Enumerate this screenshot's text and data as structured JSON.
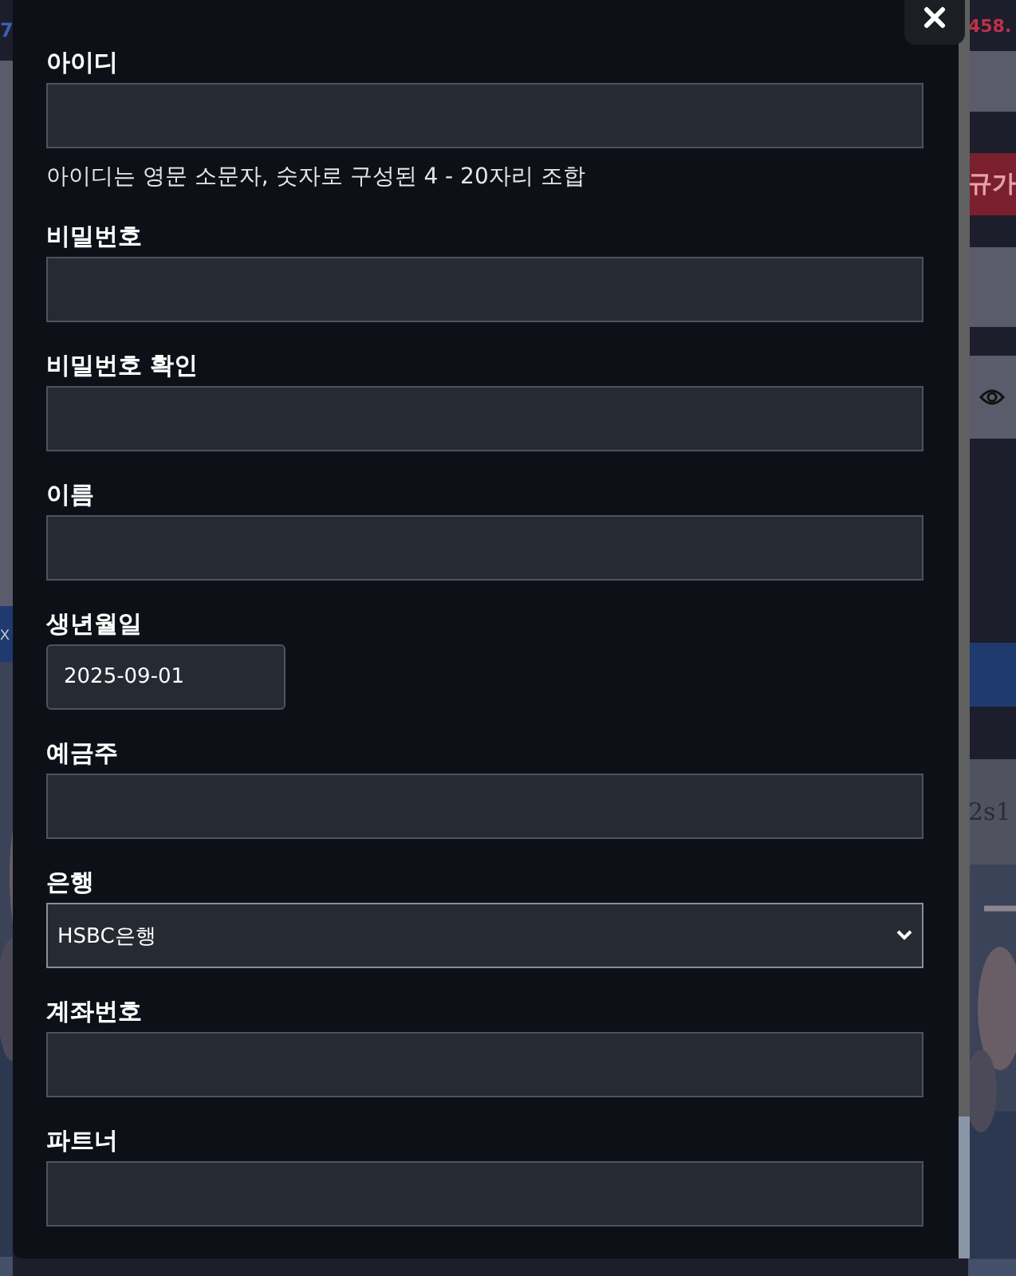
{
  "background": {
    "corner_text": "7",
    "price_text": "458.",
    "signup_button": "규가",
    "side_button": "X",
    "banner_text": "2s1"
  },
  "modal": {
    "fields": [
      {
        "kind": "text",
        "label": "아이디",
        "hint": "아이디는 영문 소문자, 숫자로 구성된 4 - 20자리 조합"
      },
      {
        "kind": "password",
        "label": "비밀번호"
      },
      {
        "kind": "password",
        "label": "비밀번호 확인"
      },
      {
        "kind": "text",
        "label": "이름"
      },
      {
        "kind": "date",
        "label": "생년월일",
        "value": "2025-09-01"
      },
      {
        "kind": "text",
        "label": "예금주"
      },
      {
        "kind": "select",
        "label": "은행",
        "value": "HSBC은행"
      },
      {
        "kind": "text",
        "label": "계좌번호"
      },
      {
        "kind": "text",
        "label": "파트너"
      }
    ]
  }
}
